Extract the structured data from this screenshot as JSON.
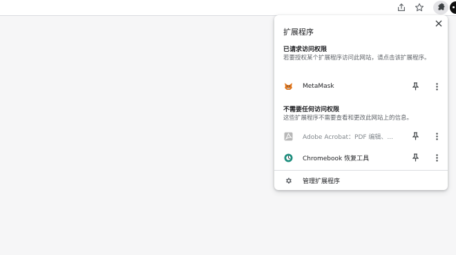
{
  "toolbar": {
    "icons": [
      "share-icon",
      "star-icon",
      "puzzle-icon",
      "avatar"
    ]
  },
  "popup": {
    "title": "扩展程序",
    "requested_section": {
      "heading": "已请求访问权限",
      "description": "若要授权某个扩展程序访问此网站，请点击该扩展程序。",
      "extensions": [
        {
          "name": "MetaMask",
          "icon": "metamask-fox-icon",
          "disabled": false
        }
      ]
    },
    "no_access_section": {
      "heading": "不需要任何访问权限",
      "description": "这些扩展程序不需要查看和更改此网站上的信息。",
      "extensions": [
        {
          "name": "Adobe Acrobat：PDF 编辑、...",
          "icon": "adobe-acrobat-icon",
          "disabled": true
        },
        {
          "name": "Chromebook 恢复工具",
          "icon": "chromebook-recovery-icon",
          "disabled": false
        }
      ]
    },
    "manage_label": "管理扩展程序"
  },
  "colors": {
    "page_background": "#f6f6f7",
    "popup_background": "#ffffff",
    "secondary_text": "#5f6368",
    "divider": "#dadce0"
  }
}
